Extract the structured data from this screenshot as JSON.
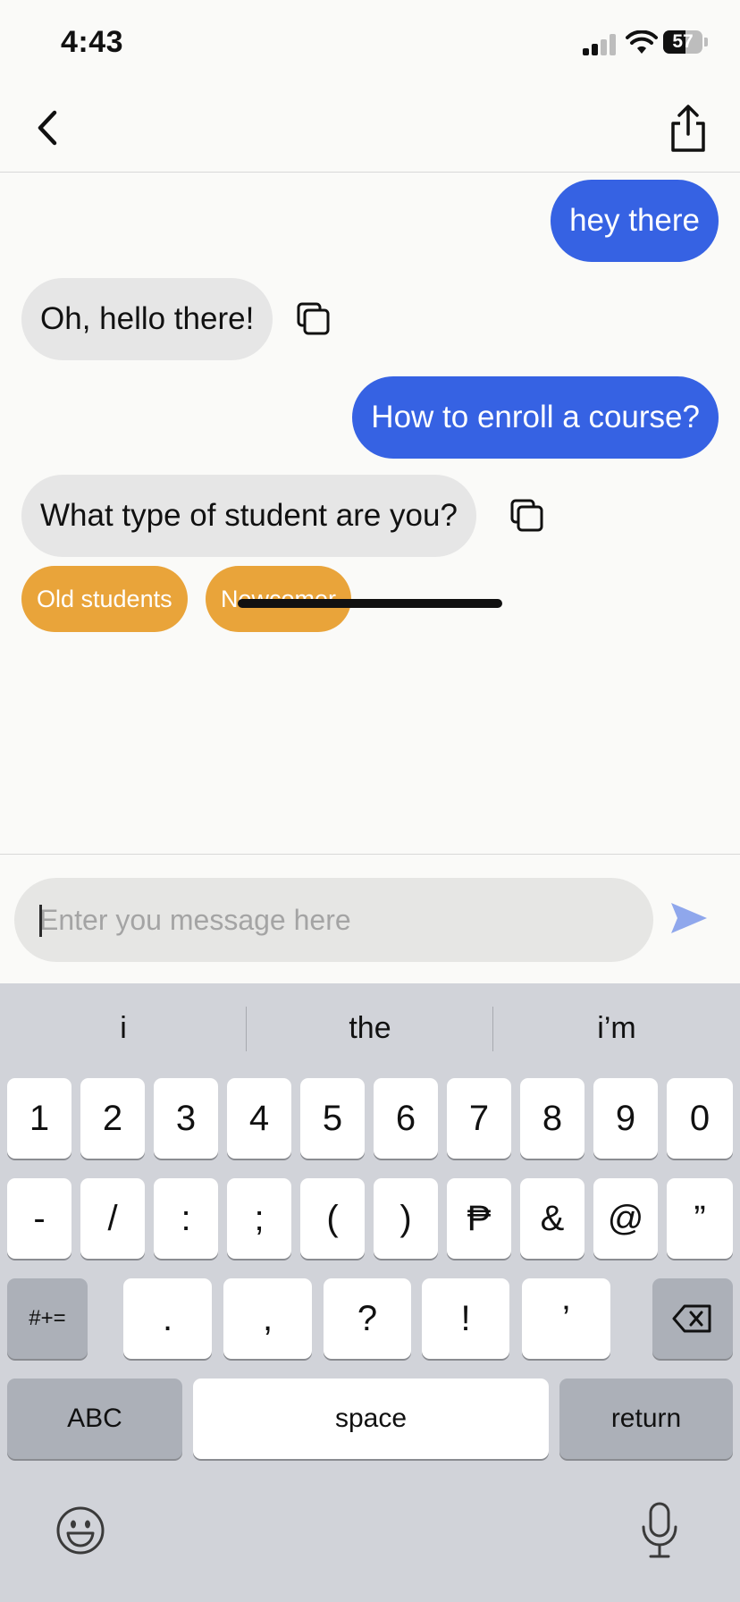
{
  "status_bar": {
    "time": "4:43",
    "battery": "57",
    "battery_level": 0.57
  },
  "chat": {
    "messages": [
      {
        "role": "user",
        "text": "hey there"
      },
      {
        "role": "bot",
        "text": "Oh, hello there!"
      },
      {
        "role": "user",
        "text": "How to enroll a course?"
      },
      {
        "role": "bot",
        "text": "What type of student are you?"
      }
    ],
    "quick_replies": [
      "Old students",
      "Newcomer"
    ]
  },
  "composer": {
    "placeholder": "Enter you message here"
  },
  "keyboard": {
    "suggestions": [
      "i",
      "the",
      "i’m"
    ],
    "row1": [
      "1",
      "2",
      "3",
      "4",
      "5",
      "6",
      "7",
      "8",
      "9",
      "0"
    ],
    "row2": [
      "-",
      "/",
      ":",
      ";",
      "(",
      ")",
      "₱",
      "&",
      "@",
      "”"
    ],
    "row3": [
      ".",
      ",",
      "?",
      "!",
      "’"
    ],
    "symbols_key": "#+=",
    "abc_key": "ABC",
    "space_key": "space",
    "return_key": "return"
  },
  "colors": {
    "user_bubble": "#3662e3",
    "bot_bubble": "#e6e6e6",
    "quick_reply": "#e9a43a",
    "send_icon": "#8fa7ec"
  }
}
